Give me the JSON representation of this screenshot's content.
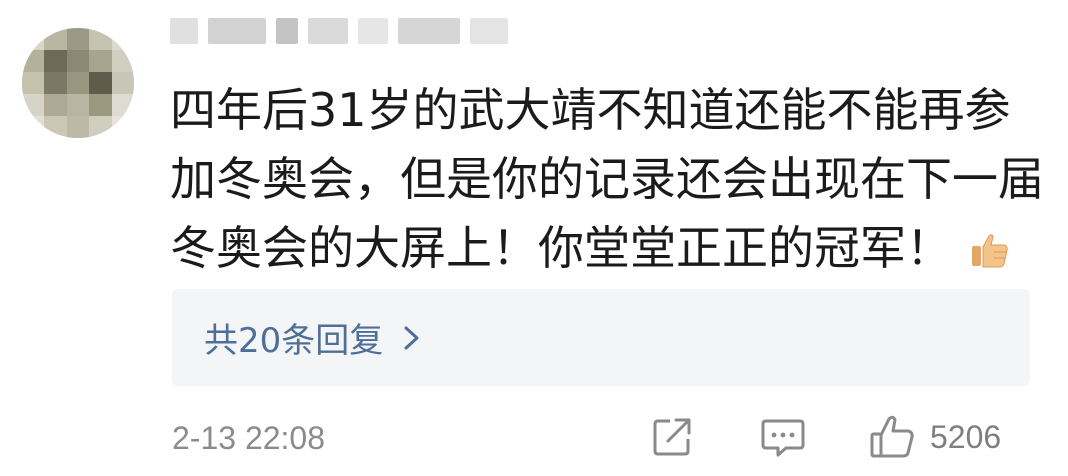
{
  "comment": {
    "lines": [
      "四年后31岁的武大靖不知道还能不能再参",
      "加冬奥会，但是你的记录还会出现在下一届",
      "冬奥会的大屏上！你堂堂正正的冠军！"
    ],
    "emoji": "thumbs-up-emoji"
  },
  "replies": {
    "label": "共20条回复"
  },
  "meta": {
    "time": "2-13 22:08",
    "like_count": "5206"
  },
  "icons": {
    "share": "share-icon",
    "reply": "comment-icon",
    "like": "thumbs-up-icon",
    "chevron": "chevron-right-icon"
  },
  "colors": {
    "text": "#1b1b1b",
    "link": "#4e6f98",
    "meta": "#8b8b8b",
    "reply_bg": "#f4f5f7",
    "icon": "#8a8a8a"
  }
}
